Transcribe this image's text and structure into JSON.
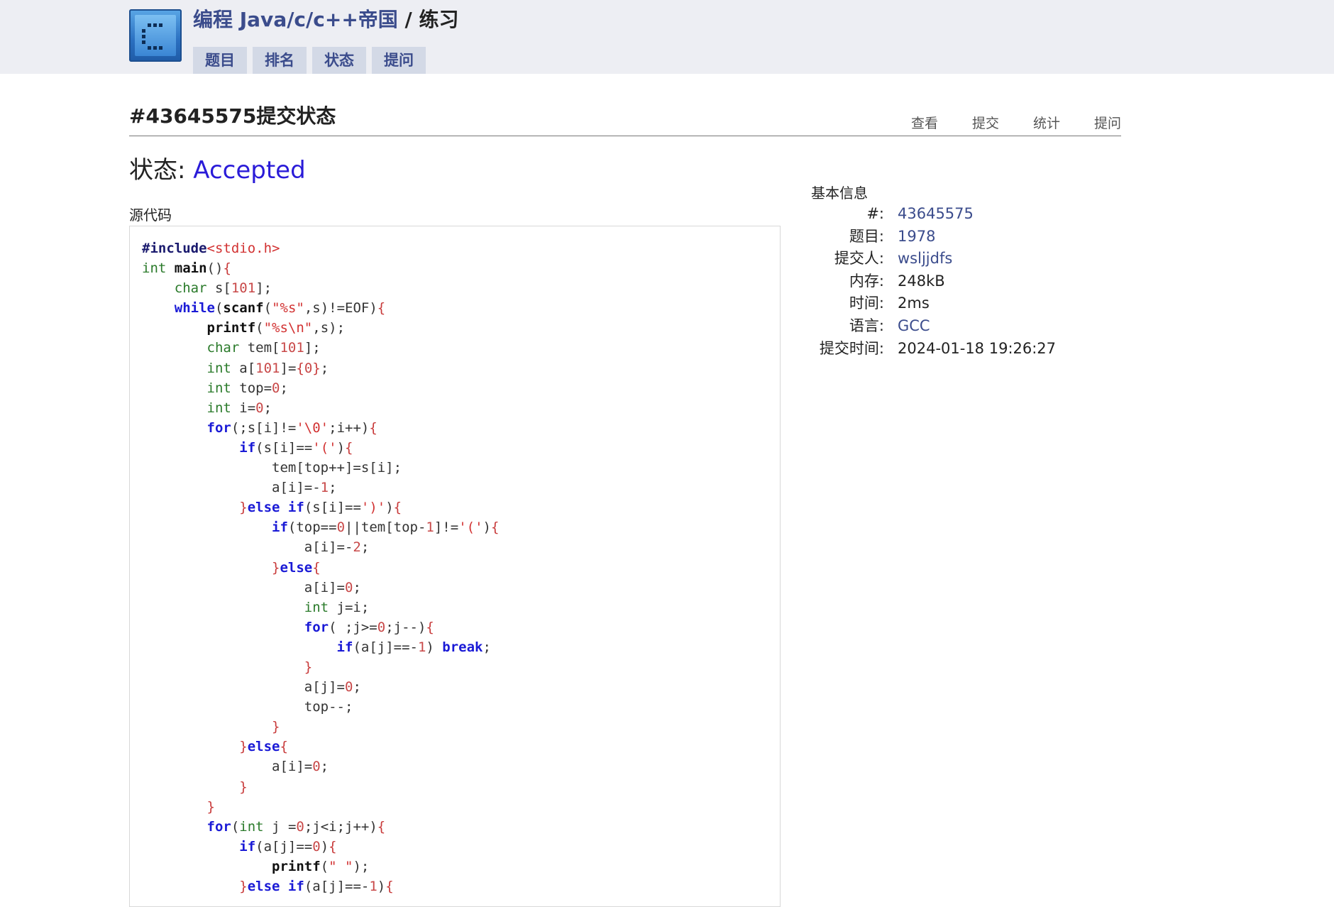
{
  "header": {
    "site_title": "编程 Java/c/c++帝国",
    "separator": " / ",
    "section": "练习",
    "nav": [
      {
        "label": "题目"
      },
      {
        "label": "排名"
      },
      {
        "label": "状态"
      },
      {
        "label": "提问"
      }
    ]
  },
  "page": {
    "title": "#43645575提交状态",
    "tabs": [
      {
        "label": "查看"
      },
      {
        "label": "提交"
      },
      {
        "label": "统计"
      },
      {
        "label": "提问"
      }
    ]
  },
  "status": {
    "label": "状态:",
    "value": "Accepted",
    "value_color": "#2a1bd8"
  },
  "source": {
    "label": "源代码",
    "lines": [
      [
        {
          "c": "pp",
          "t": "#include"
        },
        {
          "c": "st",
          "t": "<stdio.h>"
        }
      ],
      [
        {
          "c": "ty",
          "t": "int"
        },
        {
          "c": "id",
          "t": " "
        },
        {
          "c": "fn",
          "t": "main"
        },
        {
          "c": "id",
          "t": "()"
        },
        {
          "c": "br",
          "t": "{"
        }
      ],
      [
        {
          "c": "id",
          "t": "    "
        },
        {
          "c": "ty",
          "t": "char"
        },
        {
          "c": "id",
          "t": " s["
        },
        {
          "c": "nm",
          "t": "101"
        },
        {
          "c": "id",
          "t": "];"
        }
      ],
      [
        {
          "c": "id",
          "t": "    "
        },
        {
          "c": "kw",
          "t": "while"
        },
        {
          "c": "id",
          "t": "("
        },
        {
          "c": "fn",
          "t": "scanf"
        },
        {
          "c": "id",
          "t": "("
        },
        {
          "c": "st",
          "t": "\"%s\""
        },
        {
          "c": "id",
          "t": ",s)!=EOF)"
        },
        {
          "c": "br",
          "t": "{"
        }
      ],
      [
        {
          "c": "id",
          "t": "        "
        },
        {
          "c": "fn",
          "t": "printf"
        },
        {
          "c": "id",
          "t": "("
        },
        {
          "c": "st",
          "t": "\"%s\\n\""
        },
        {
          "c": "id",
          "t": ",s);"
        }
      ],
      [
        {
          "c": "id",
          "t": "        "
        },
        {
          "c": "ty",
          "t": "char"
        },
        {
          "c": "id",
          "t": " tem["
        },
        {
          "c": "nm",
          "t": "101"
        },
        {
          "c": "id",
          "t": "];"
        }
      ],
      [
        {
          "c": "id",
          "t": "        "
        },
        {
          "c": "ty",
          "t": "int"
        },
        {
          "c": "id",
          "t": " a["
        },
        {
          "c": "nm",
          "t": "101"
        },
        {
          "c": "id",
          "t": "]="
        },
        {
          "c": "br",
          "t": "{"
        },
        {
          "c": "nm",
          "t": "0"
        },
        {
          "c": "br",
          "t": "}"
        },
        {
          "c": "id",
          "t": ";"
        }
      ],
      [
        {
          "c": "id",
          "t": "        "
        },
        {
          "c": "ty",
          "t": "int"
        },
        {
          "c": "id",
          "t": " top="
        },
        {
          "c": "nm",
          "t": "0"
        },
        {
          "c": "id",
          "t": ";"
        }
      ],
      [
        {
          "c": "id",
          "t": "        "
        },
        {
          "c": "ty",
          "t": "int"
        },
        {
          "c": "id",
          "t": " i="
        },
        {
          "c": "nm",
          "t": "0"
        },
        {
          "c": "id",
          "t": ";"
        }
      ],
      [
        {
          "c": "id",
          "t": "        "
        },
        {
          "c": "kw",
          "t": "for"
        },
        {
          "c": "id",
          "t": "(;s[i]!="
        },
        {
          "c": "st",
          "t": "'\\0'"
        },
        {
          "c": "id",
          "t": ";i++)"
        },
        {
          "c": "br",
          "t": "{"
        }
      ],
      [
        {
          "c": "id",
          "t": "            "
        },
        {
          "c": "kw",
          "t": "if"
        },
        {
          "c": "id",
          "t": "(s[i]=="
        },
        {
          "c": "st",
          "t": "'('"
        },
        {
          "c": "id",
          "t": ")"
        },
        {
          "c": "br",
          "t": "{"
        }
      ],
      [
        {
          "c": "id",
          "t": "                tem[top++]=s[i];"
        }
      ],
      [
        {
          "c": "id",
          "t": "                a[i]=-"
        },
        {
          "c": "nm",
          "t": "1"
        },
        {
          "c": "id",
          "t": ";"
        }
      ],
      [
        {
          "c": "id",
          "t": "            "
        },
        {
          "c": "br",
          "t": "}"
        },
        {
          "c": "kw",
          "t": "else if"
        },
        {
          "c": "id",
          "t": "(s[i]=="
        },
        {
          "c": "st",
          "t": "')'"
        },
        {
          "c": "id",
          "t": ")"
        },
        {
          "c": "br",
          "t": "{"
        }
      ],
      [
        {
          "c": "id",
          "t": "                "
        },
        {
          "c": "kw",
          "t": "if"
        },
        {
          "c": "id",
          "t": "(top=="
        },
        {
          "c": "nm",
          "t": "0"
        },
        {
          "c": "id",
          "t": "||tem[top-"
        },
        {
          "c": "nm",
          "t": "1"
        },
        {
          "c": "id",
          "t": "]!="
        },
        {
          "c": "st",
          "t": "'('"
        },
        {
          "c": "id",
          "t": ")"
        },
        {
          "c": "br",
          "t": "{"
        }
      ],
      [
        {
          "c": "id",
          "t": "                    a[i]=-"
        },
        {
          "c": "nm",
          "t": "2"
        },
        {
          "c": "id",
          "t": ";"
        }
      ],
      [
        {
          "c": "id",
          "t": "                "
        },
        {
          "c": "br",
          "t": "}"
        },
        {
          "c": "kw",
          "t": "else"
        },
        {
          "c": "br",
          "t": "{"
        }
      ],
      [
        {
          "c": "id",
          "t": "                    a[i]="
        },
        {
          "c": "nm",
          "t": "0"
        },
        {
          "c": "id",
          "t": ";"
        }
      ],
      [
        {
          "c": "id",
          "t": "                    "
        },
        {
          "c": "ty",
          "t": "int"
        },
        {
          "c": "id",
          "t": " j=i;"
        }
      ],
      [
        {
          "c": "id",
          "t": "                    "
        },
        {
          "c": "kw",
          "t": "for"
        },
        {
          "c": "id",
          "t": "( ;j>="
        },
        {
          "c": "nm",
          "t": "0"
        },
        {
          "c": "id",
          "t": ";j--)"
        },
        {
          "c": "br",
          "t": "{"
        }
      ],
      [
        {
          "c": "id",
          "t": "                        "
        },
        {
          "c": "kw",
          "t": "if"
        },
        {
          "c": "id",
          "t": "(a[j]==-"
        },
        {
          "c": "nm",
          "t": "1"
        },
        {
          "c": "id",
          "t": ") "
        },
        {
          "c": "kw",
          "t": "break"
        },
        {
          "c": "id",
          "t": ";"
        }
      ],
      [
        {
          "c": "id",
          "t": "                    "
        },
        {
          "c": "br",
          "t": "}"
        }
      ],
      [
        {
          "c": "id",
          "t": "                    a[j]="
        },
        {
          "c": "nm",
          "t": "0"
        },
        {
          "c": "id",
          "t": ";"
        }
      ],
      [
        {
          "c": "id",
          "t": "                    top--;"
        }
      ],
      [
        {
          "c": "id",
          "t": "                "
        },
        {
          "c": "br",
          "t": "}"
        }
      ],
      [
        {
          "c": "id",
          "t": "            "
        },
        {
          "c": "br",
          "t": "}"
        },
        {
          "c": "kw",
          "t": "else"
        },
        {
          "c": "br",
          "t": "{"
        }
      ],
      [
        {
          "c": "id",
          "t": "                a[i]="
        },
        {
          "c": "nm",
          "t": "0"
        },
        {
          "c": "id",
          "t": ";"
        }
      ],
      [
        {
          "c": "id",
          "t": "            "
        },
        {
          "c": "br",
          "t": "}"
        }
      ],
      [
        {
          "c": "id",
          "t": "        "
        },
        {
          "c": "br",
          "t": "}"
        }
      ],
      [
        {
          "c": "id",
          "t": "        "
        },
        {
          "c": "kw",
          "t": "for"
        },
        {
          "c": "id",
          "t": "("
        },
        {
          "c": "ty",
          "t": "int"
        },
        {
          "c": "id",
          "t": " j ="
        },
        {
          "c": "nm",
          "t": "0"
        },
        {
          "c": "id",
          "t": ";j<i;j++)"
        },
        {
          "c": "br",
          "t": "{"
        }
      ],
      [
        {
          "c": "id",
          "t": "            "
        },
        {
          "c": "kw",
          "t": "if"
        },
        {
          "c": "id",
          "t": "(a[j]=="
        },
        {
          "c": "nm",
          "t": "0"
        },
        {
          "c": "id",
          "t": ")"
        },
        {
          "c": "br",
          "t": "{"
        }
      ],
      [
        {
          "c": "id",
          "t": "                "
        },
        {
          "c": "fn",
          "t": "printf"
        },
        {
          "c": "id",
          "t": "("
        },
        {
          "c": "st",
          "t": "\" \""
        },
        {
          "c": "id",
          "t": ");"
        }
      ],
      [
        {
          "c": "id",
          "t": "            "
        },
        {
          "c": "br",
          "t": "}"
        },
        {
          "c": "kw",
          "t": "else if"
        },
        {
          "c": "id",
          "t": "(a[j]==-"
        },
        {
          "c": "nm",
          "t": "1"
        },
        {
          "c": "id",
          "t": ")"
        },
        {
          "c": "br",
          "t": "{"
        }
      ]
    ]
  },
  "info": {
    "title": "基本信息",
    "rows": [
      {
        "key": "#:",
        "value": "43645575",
        "link": true
      },
      {
        "key": "题目:",
        "value": "1978",
        "link": true
      },
      {
        "key": "提交人:",
        "value": "wsljjdfs",
        "link": true
      },
      {
        "key": "内存:",
        "value": "248kB",
        "link": false
      },
      {
        "key": "时间:",
        "value": "2ms",
        "link": false
      },
      {
        "key": "语言:",
        "value": "GCC",
        "link": true
      },
      {
        "key": "提交时间:",
        "value": "2024-01-18 19:26:27",
        "link": false
      }
    ]
  },
  "icons": {
    "logo": "site-logo-icon"
  }
}
